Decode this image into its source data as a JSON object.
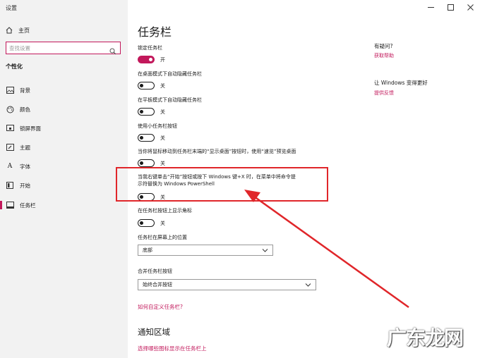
{
  "window": {
    "title": "设置",
    "controls": [
      "minimize",
      "maximize",
      "close"
    ]
  },
  "sidebar": {
    "home_label": "主页",
    "search_placeholder": "查找设置",
    "section_title": "个性化",
    "items": [
      {
        "label": "背景",
        "icon": "image-icon",
        "active": false
      },
      {
        "label": "颜色",
        "icon": "palette-icon",
        "active": false
      },
      {
        "label": "锁屏界面",
        "icon": "lockscreen-icon",
        "active": false
      },
      {
        "label": "主题",
        "icon": "brush-icon",
        "active": false
      },
      {
        "label": "字体",
        "icon": "font-icon",
        "active": false
      },
      {
        "label": "开始",
        "icon": "start-icon",
        "active": false
      },
      {
        "label": "任务栏",
        "icon": "taskbar-icon",
        "active": true
      }
    ]
  },
  "main": {
    "title": "任务栏",
    "settings": [
      {
        "label": "锁定任务栏",
        "state": "开",
        "on": true
      },
      {
        "label": "在桌面模式下自动隐藏任务栏",
        "state": "关",
        "on": false
      },
      {
        "label": "在平板模式下自动隐藏任务栏",
        "state": "关",
        "on": false
      },
      {
        "label": "使用小任务栏按钮",
        "state": "关",
        "on": false
      },
      {
        "label": "当你将鼠标移动到任务栏末端的“显示桌面”按钮时，使用“速览”预览桌面",
        "state": "关",
        "on": false
      },
      {
        "label_line1": "当我右键单击“开始”按钮或按下 Windows 键+X 时，在菜单中将命令提",
        "label_line2": "示符替换为 Windows PowerShell",
        "state": "关",
        "on": false,
        "highlighted": true
      },
      {
        "label": "在任务栏按钮上显示角标",
        "state": "关",
        "on": false
      }
    ],
    "position": {
      "label": "任务栏在屏幕上的位置",
      "value": "底部"
    },
    "combine": {
      "label": "合并任务栏按钮",
      "value": "始终合并按钮"
    },
    "customize_link": "如何自定义任务栏?",
    "notification_heading": "通知区域",
    "notification_link": "选择哪些图标显示在任务栏上"
  },
  "right_panel": {
    "question_heading": "有疑问?",
    "help_link": "获取帮助",
    "improve_heading": "让 Windows 变得更好",
    "feedback_link": "提供反馈"
  },
  "annotation": {
    "box_color": "#e0262a",
    "arrow_color": "#e0262a"
  },
  "watermark": "广东龙网",
  "colors": {
    "accent": "#c2185b",
    "sidebar_bg": "#f2f2f2"
  }
}
